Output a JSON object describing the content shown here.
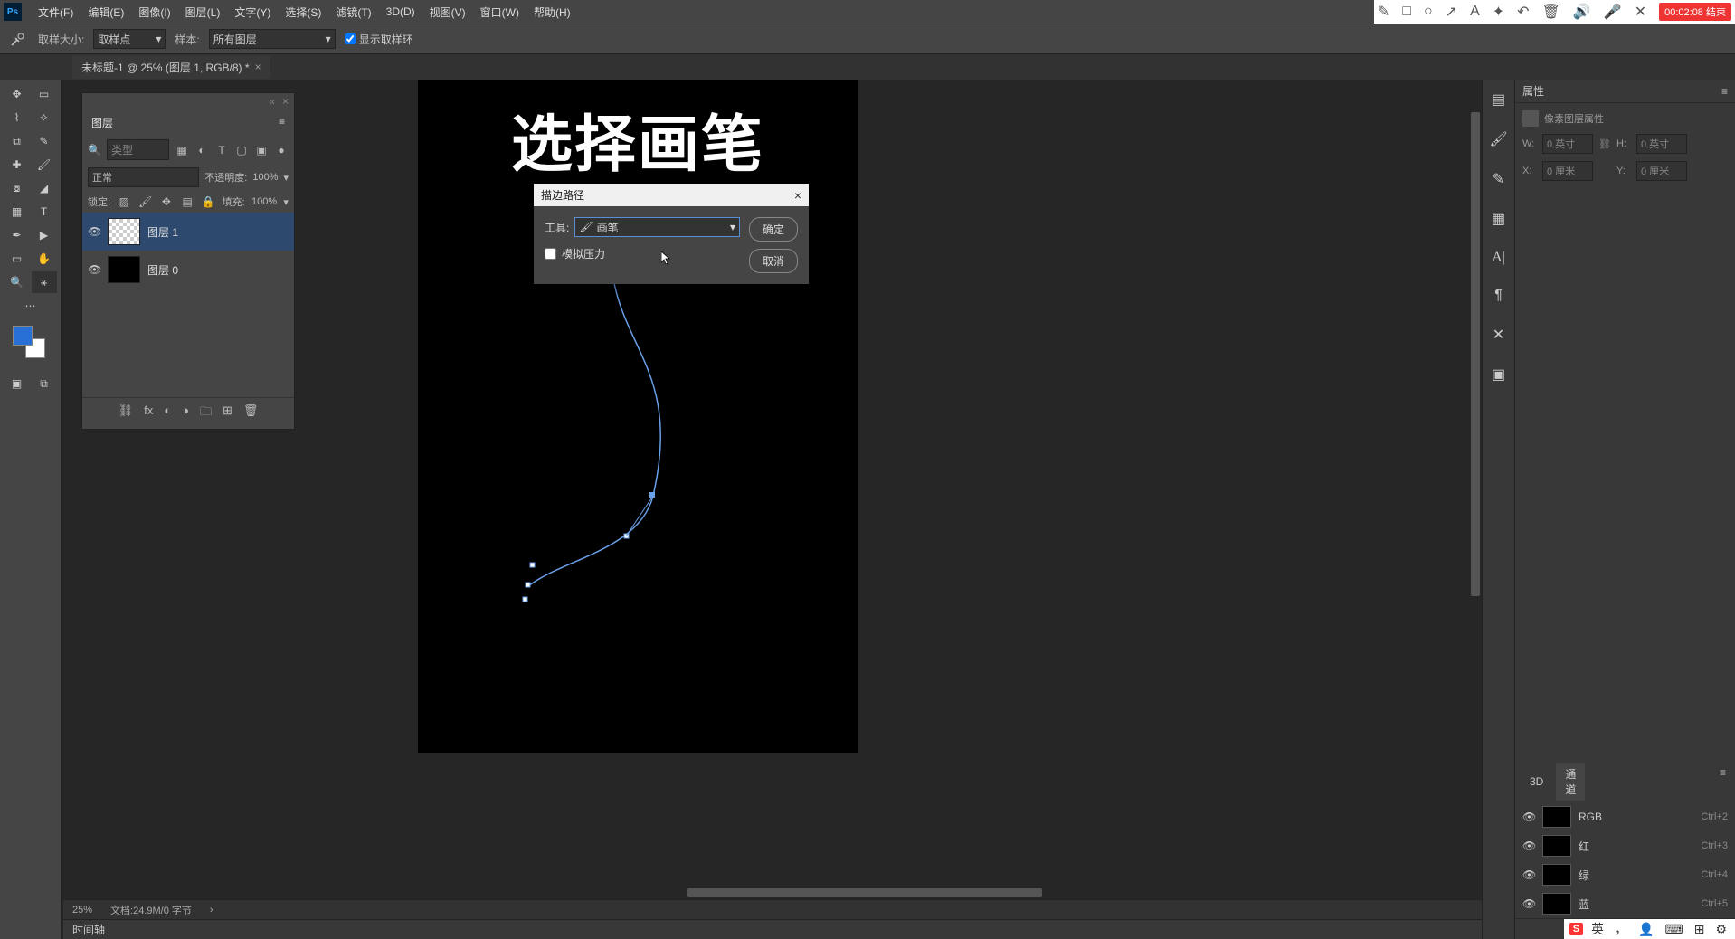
{
  "menubar": {
    "logo": "Ps",
    "items": [
      "文件(F)",
      "编辑(E)",
      "图像(I)",
      "图层(L)",
      "文字(Y)",
      "选择(S)",
      "滤镜(T)",
      "3D(D)",
      "视图(V)",
      "窗口(W)",
      "帮助(H)"
    ]
  },
  "recorder": {
    "time": "00:02:08",
    "label": "结束"
  },
  "options": {
    "sample_size_label": "取样大小:",
    "sample_size_value": "取样点",
    "sample_label": "样本:",
    "sample_value": "所有图层",
    "show_ring": "显示取样环"
  },
  "tab": {
    "title": "未标题-1 @ 25% (图层 1, RGB/8) *"
  },
  "canvas": {
    "headline": "选择画笔"
  },
  "layers_panel": {
    "title": "图层",
    "search_placeholder": "类型",
    "blend_mode": "正常",
    "opacity_label": "不透明度:",
    "opacity_value": "100%",
    "lock_label": "锁定:",
    "fill_label": "填充:",
    "fill_value": "100%",
    "layers": [
      {
        "name": "图层 1",
        "selected": true,
        "black": false
      },
      {
        "name": "图层 0",
        "selected": false,
        "black": true
      }
    ]
  },
  "dialog": {
    "title": "描边路径",
    "tool_label": "工具:",
    "tool_value": "画笔",
    "sim_pressure": "模拟压力",
    "ok": "确定",
    "cancel": "取消"
  },
  "properties": {
    "title": "属性",
    "subtitle": "像素图层属性",
    "w_label": "W:",
    "w_value": "0 英寸",
    "h_label": "H:",
    "h_value": "0 英寸",
    "x_label": "X:",
    "x_value": "0 厘米",
    "y_label": "Y:",
    "y_value": "0 厘米"
  },
  "channels": {
    "title_3d": "3D",
    "title": "通道",
    "items": [
      {
        "name": "RGB",
        "shortcut": "Ctrl+2"
      },
      {
        "name": "红",
        "shortcut": "Ctrl+3"
      },
      {
        "name": "绿",
        "shortcut": "Ctrl+4"
      },
      {
        "name": "蓝",
        "shortcut": "Ctrl+5"
      }
    ]
  },
  "status": {
    "zoom": "25%",
    "doc": "文档:24.9M/0 字节"
  },
  "timeline": {
    "label": "时间轴"
  },
  "ime": {
    "lang": "英"
  }
}
